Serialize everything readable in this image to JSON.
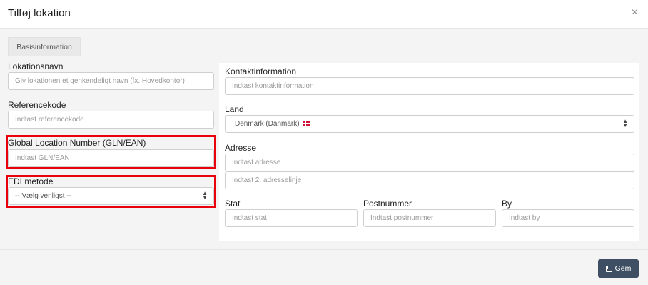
{
  "dialog": {
    "title": "Tilføj lokation",
    "close_symbol": "×"
  },
  "tabs": [
    {
      "label": "Basisinformation",
      "active": true
    }
  ],
  "left": {
    "location_name": {
      "label": "Lokationsnavn",
      "placeholder": "Giv lokationen et genkendeligt navn (fx. Hovedkontor)"
    },
    "reference_code": {
      "label": "Referencekode",
      "placeholder": "Indtast referencekode"
    },
    "gln": {
      "label": "Global Location Number (GLN/EAN)",
      "placeholder": "Indtast GLN/EAN"
    },
    "edi": {
      "label": "EDI metode",
      "selected": "-- Vælg venligst --"
    }
  },
  "right": {
    "contact": {
      "label": "Kontaktinformation",
      "placeholder": "Indtast kontaktinformation"
    },
    "country": {
      "label": "Land",
      "selected": "Denmark (Danmark)",
      "flag": "dk-flag-icon"
    },
    "address": {
      "label": "Adresse",
      "placeholder1": "Indtast adresse",
      "placeholder2": "Indtast 2. adresselinje"
    },
    "state": {
      "label": "Stat",
      "placeholder": "Indtast stat"
    },
    "postal": {
      "label": "Postnummer",
      "placeholder": "Indtast postnummer"
    },
    "city": {
      "label": "By",
      "placeholder": "Indtast by"
    }
  },
  "footer": {
    "save_label": "Gem",
    "save_icon": "floppy-disk-icon"
  },
  "colors": {
    "highlight": "#e8000d",
    "save_button": "#3e4f63",
    "background": "#f4f4f4"
  }
}
